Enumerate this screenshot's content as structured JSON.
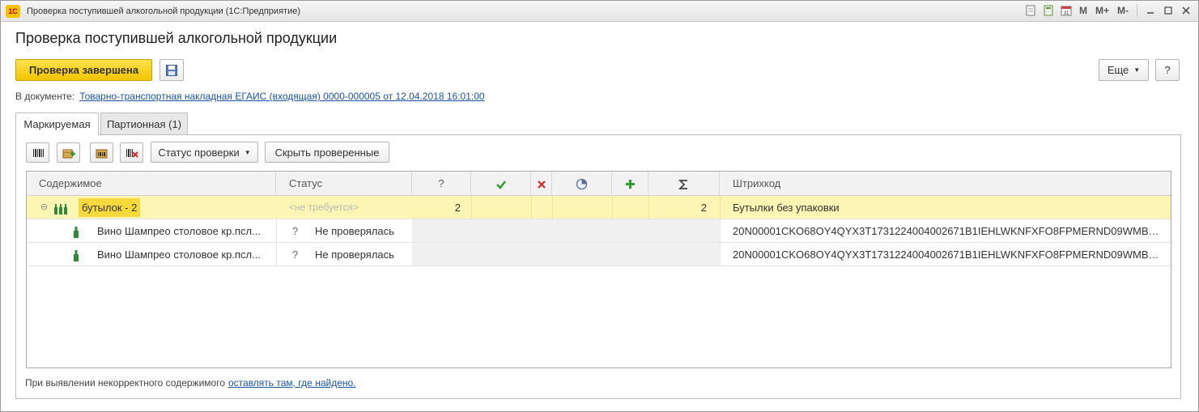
{
  "window": {
    "title": "Проверка поступившей алкогольной продукции (1С:Предприятие)",
    "tools": [
      "М",
      "М+",
      "М-"
    ]
  },
  "page": {
    "title": "Проверка поступившей алкогольной продукции"
  },
  "toolbar": {
    "complete_label": "Проверка завершена",
    "more_label": "Еще",
    "help_label": "?"
  },
  "document": {
    "prefix": "В документе:",
    "link": "Товарно-транспортная накладная ЕГАИС (входящая) 0000-000005 от 12.04.2018 16:01:00"
  },
  "tabs": [
    {
      "label": "Маркируемая",
      "active": true
    },
    {
      "label": "Партионная (1)",
      "active": false
    }
  ],
  "panel_toolbar": {
    "status_label": "Статус проверки",
    "hide_label": "Скрыть проверенные"
  },
  "table": {
    "headers": {
      "content": "Содержимое",
      "status": "Статус",
      "question": "?",
      "barcode": "Штрихкод"
    },
    "group_row": {
      "content": "бутылок -  2",
      "status": "<не требуется>",
      "question_count": "2",
      "sum": "2",
      "barcode": "Бутылки без упаковки"
    },
    "rows": [
      {
        "content": "Вино Шампрео столовое кр.псл...",
        "status_mark": "?",
        "status": "Не проверялась",
        "barcode": "20N00001CKO68OY4QYX3T1731224004002671B1IEHLWKNFXFO8FPMERND09WMB8..."
      },
      {
        "content": "Вино Шампрео столовое кр.псл...",
        "status_mark": "?",
        "status": "Не проверялась",
        "barcode": "20N00001CKO68OY4QYX3T1731224004002671B1IEHLWKNFXFO8FPMERND09WMB8..."
      }
    ]
  },
  "footer": {
    "prefix": "При выявлении некорректного содержимого",
    "link": "оставлять там, где найдено."
  },
  "colors": {
    "primary_button": "#f2c500",
    "group_row_bg": "#fdf5b4",
    "link": "#1a53a8",
    "check_green": "#2e9e2e",
    "cross_red": "#d62b2b"
  }
}
